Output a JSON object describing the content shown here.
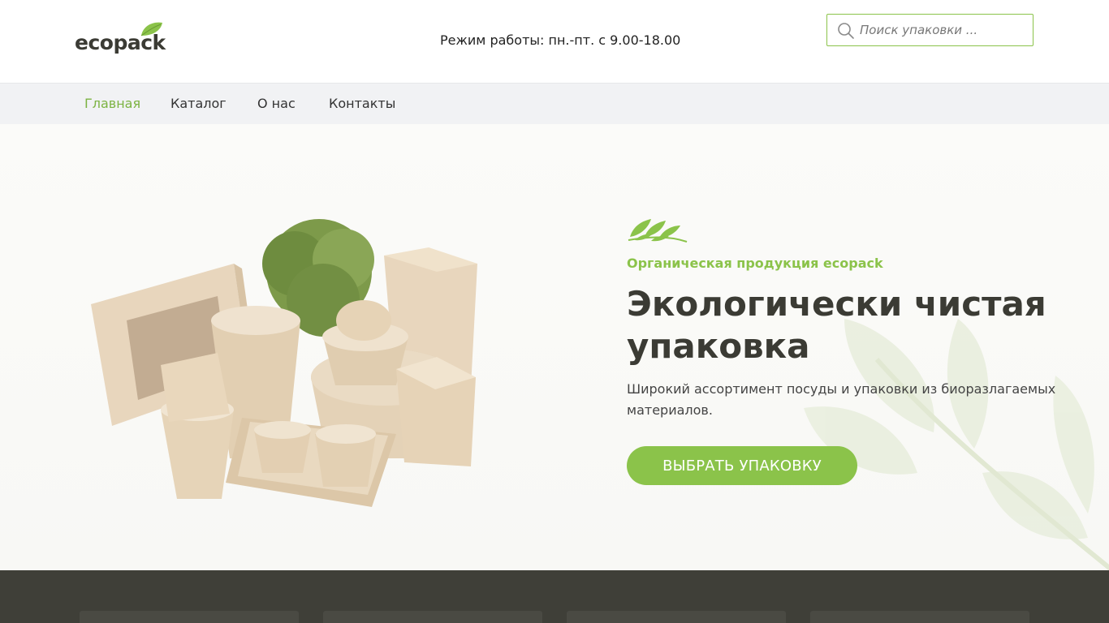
{
  "header": {
    "logo_text": "ecopack",
    "hours": "Режим работы: пн.-пт. с 9.00-18.00",
    "search_placeholder": "Поиск упаковки ..."
  },
  "nav": {
    "items": [
      {
        "label": "Главная",
        "active": true
      },
      {
        "label": "Каталог",
        "active": false
      },
      {
        "label": "О нас",
        "active": false
      },
      {
        "label": "Контакты",
        "active": false
      }
    ]
  },
  "hero": {
    "subtitle": "Органическая продукция ecopack",
    "title": "Экологически чистая упаковка",
    "description": "Широкий ассортимент посуды и упаковки из биоразлагаемых материалов.",
    "cta_label": "ВЫБРАТЬ УПАКОВКУ"
  },
  "colors": {
    "accent": "#8bc34a",
    "dark": "#3f3f38",
    "nav_bg": "#f1f2f4"
  }
}
